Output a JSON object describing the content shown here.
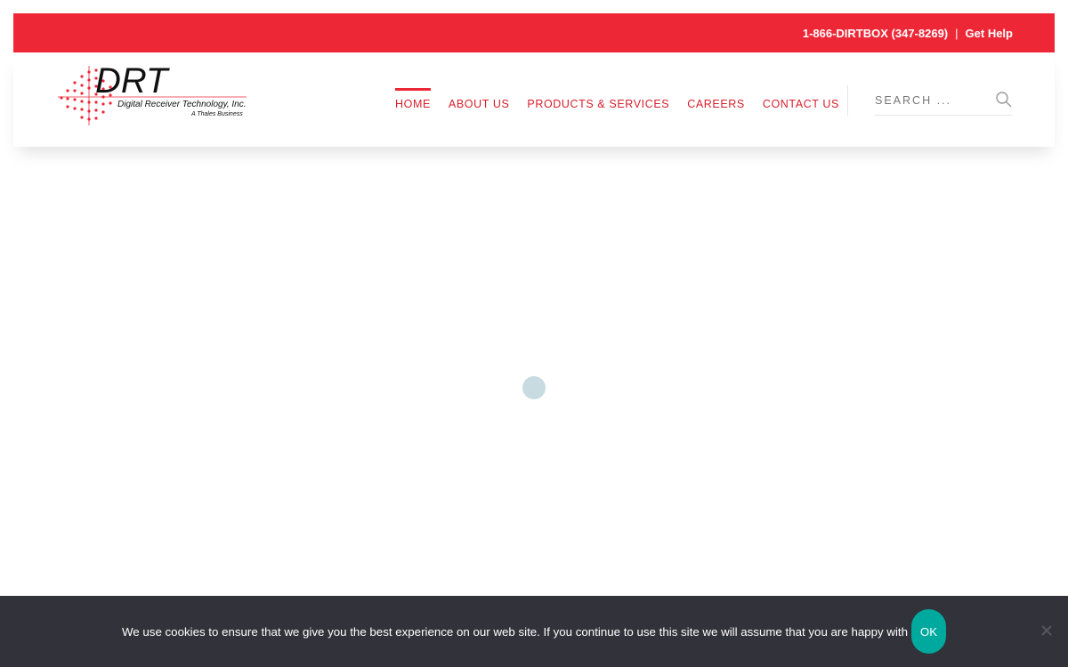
{
  "topbar": {
    "phone": "1-866-DIRTBOX (347-8269)",
    "separator": "|",
    "help_link": "Get Help",
    "bg_color": "#ee2737"
  },
  "logo": {
    "wordmark": "DRT",
    "company": "Digital Receiver Technology, Inc.",
    "tagline": "A Thales Business"
  },
  "nav": {
    "items": [
      {
        "label": "HOME",
        "active": true
      },
      {
        "label": "ABOUT US",
        "active": false
      },
      {
        "label": "PRODUCTS & SERVICES",
        "active": false
      },
      {
        "label": "CAREERS",
        "active": false
      },
      {
        "label": "CONTACT US",
        "active": false
      }
    ],
    "accent_color": "#ee2737"
  },
  "search": {
    "placeholder": "SEARCH ...",
    "icon": "search-icon"
  },
  "loader": {
    "icon": "loading-spinner",
    "color": "#c7dbe1"
  },
  "cookie_banner": {
    "message": "We use cookies to ensure that we give you the best experience on our web site. If you continue to use this site we will assume that you are happy with it.",
    "ok_label": "OK",
    "close_icon": "close-icon",
    "button_color": "#00a99d"
  }
}
